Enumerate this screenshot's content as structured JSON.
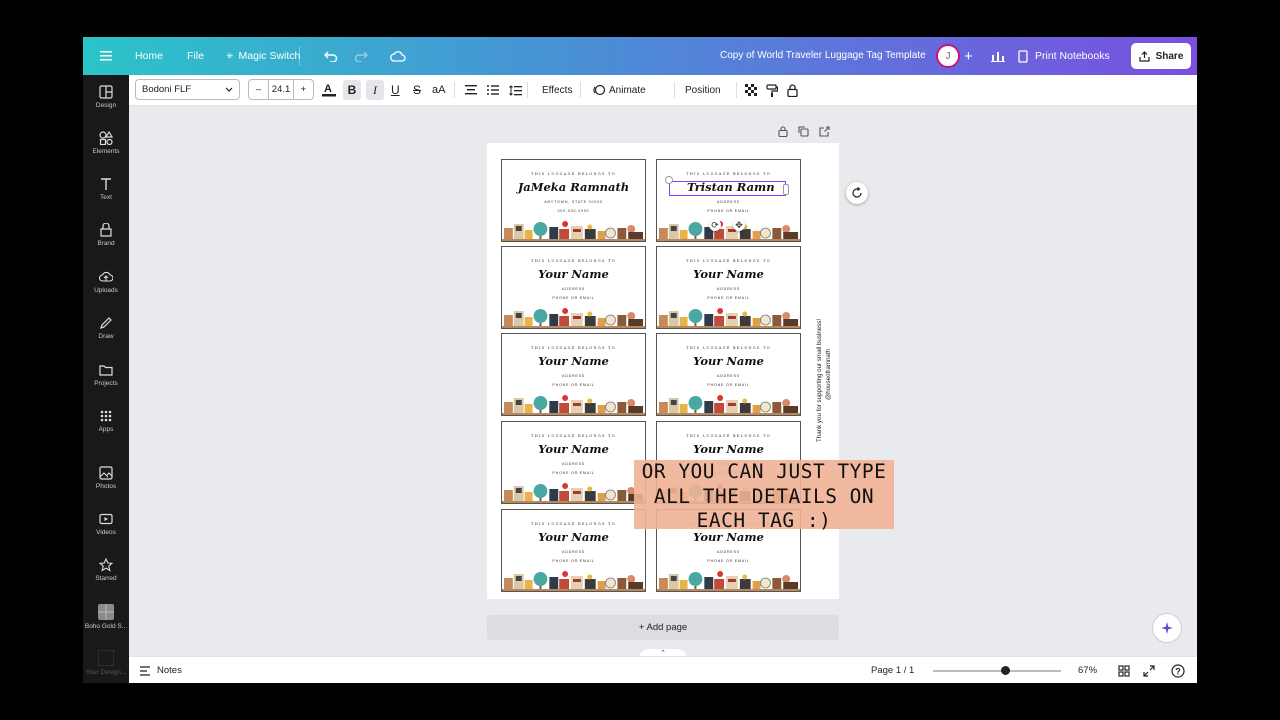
{
  "topbar": {
    "home": "Home",
    "file": "File",
    "magic_switch": "Magic Switch",
    "doc_title": "Copy of World Traveler Luggage Tag Template",
    "avatar_initial": "J",
    "print_label": "Print Notebooks",
    "share_label": "Share"
  },
  "toolbar": {
    "font": "Bodoni FLF",
    "size_minus": "–",
    "size": "24.1",
    "size_plus": "+",
    "bold": "B",
    "italic": "I",
    "underline": "U",
    "strike": "S",
    "case": "aA",
    "effects": "Effects",
    "animate": "Animate",
    "position": "Position"
  },
  "sidebar": {
    "items": [
      {
        "label": "Design",
        "icon": "design-icon"
      },
      {
        "label": "Elements",
        "icon": "elements-icon"
      },
      {
        "label": "Text",
        "icon": "text-icon"
      },
      {
        "label": "Brand",
        "icon": "brand-icon"
      },
      {
        "label": "Uploads",
        "icon": "uploads-icon"
      },
      {
        "label": "Draw",
        "icon": "draw-icon"
      },
      {
        "label": "Projects",
        "icon": "projects-icon"
      },
      {
        "label": "Apps",
        "icon": "apps-icon"
      },
      {
        "label": "Photos",
        "icon": "photos-icon"
      },
      {
        "label": "Videos",
        "icon": "videos-icon"
      },
      {
        "label": "Starred",
        "icon": "starred-icon"
      },
      {
        "label": "Boho Gold S...",
        "icon": "folder-thumb-icon"
      },
      {
        "label": "Your Design...",
        "icon": "design-thumb-icon"
      }
    ]
  },
  "tags": [
    {
      "top": "THIS LUGGAGE BELONGS TO",
      "name": "JaMeka Ramnath",
      "l1": "ANYTOWN, STATE 00000",
      "l2": "000-000-0000"
    },
    {
      "top": "THIS LUGGAGE BELONGS TO",
      "name": "Tristan Ramn",
      "l1": "ADDRESS",
      "l2": "PHONE OR EMAIL"
    },
    {
      "top": "THIS LUGGAGE BELONGS TO",
      "name": "Your Name",
      "l1": "ADDRESS",
      "l2": "PHONE OR EMAIL"
    },
    {
      "top": "THIS LUGGAGE BELONGS TO",
      "name": "Your Name",
      "l1": "ADDRESS",
      "l2": "PHONE OR EMAIL"
    },
    {
      "top": "THIS LUGGAGE BELONGS TO",
      "name": "Your Name",
      "l1": "ADDRESS",
      "l2": "PHONE OR EMAIL"
    },
    {
      "top": "THIS LUGGAGE BELONGS TO",
      "name": "Your Name",
      "l1": "ADDRESS",
      "l2": "PHONE OR EMAIL"
    },
    {
      "top": "THIS LUGGAGE BELONGS TO",
      "name": "Your Name",
      "l1": "ADDRESS",
      "l2": "PHONE OR EMAIL"
    },
    {
      "top": "THIS LUGGAGE BELONGS TO",
      "name": "Your Name",
      "l1": "ADDRESS",
      "l2": "PHONE OR EMAIL"
    },
    {
      "top": "THIS LUGGAGE BELONGS TO",
      "name": "Your Name",
      "l1": "ADDRESS",
      "l2": "PHONE OR EMAIL"
    },
    {
      "top": "THIS LUGGAGE BELONGS TO",
      "name": "Your Name",
      "l1": "ADDRESS",
      "l2": "PHONE OR EMAIL"
    }
  ],
  "side_text": {
    "line1": "Thank you for supporting our small business!",
    "line2": "@houseoframnath"
  },
  "overlay": {
    "line1": "OR YOU CAN JUST TYPE",
    "line2": "ALL THE DETAILS ON",
    "line3": "EACH TAG :)"
  },
  "add_page": "+ Add page",
  "footer": {
    "notes": "Notes",
    "page": "Page 1 / 1",
    "zoom": "67%",
    "zoom_level": 0.56
  },
  "colors": {
    "accent": "#7d2ae8",
    "overlay_bg": "#f0b296",
    "sidebar_bg": "#18191b"
  }
}
